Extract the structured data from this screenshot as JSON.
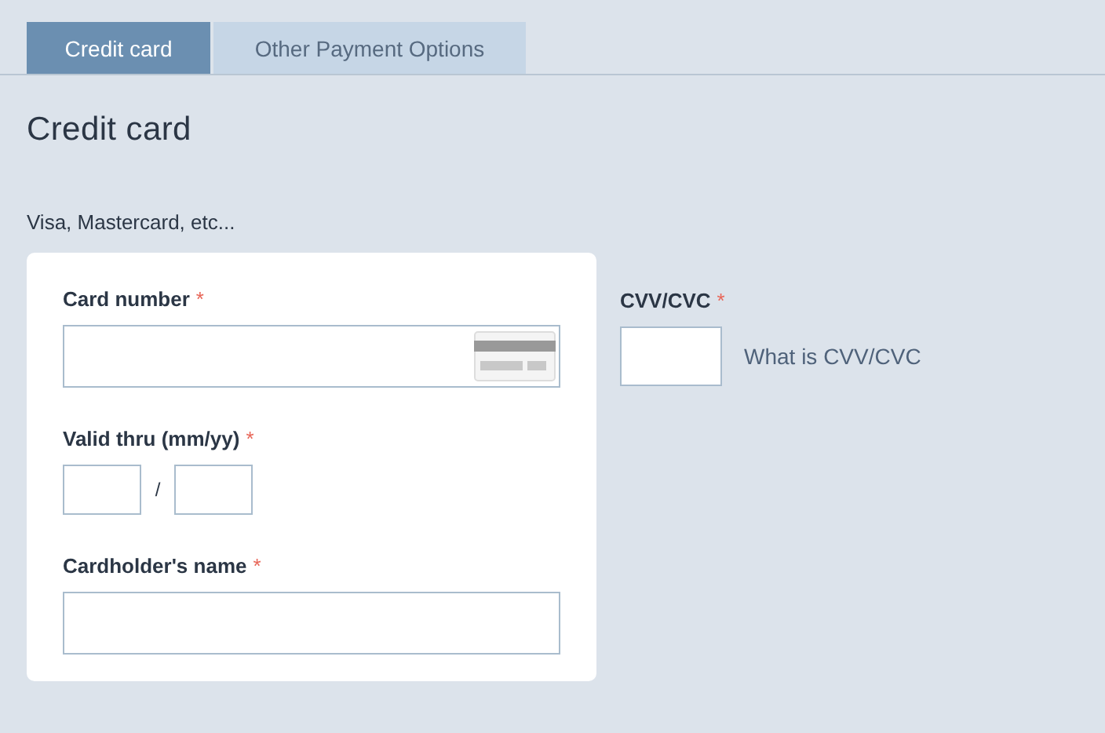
{
  "tabs": [
    {
      "label": "Credit card",
      "selected": true
    },
    {
      "label": "Other Payment Options",
      "selected": false
    }
  ],
  "heading": "Credit card",
  "subtitle": "Visa, Mastercard, etc...",
  "card_form": {
    "card_number": {
      "label": "Card number",
      "required_mark": "*"
    },
    "valid_thru": {
      "label": "Valid thru (mm/yy)",
      "required_mark": "*",
      "separator": "/"
    },
    "cardholder_name": {
      "label": "Cardholder's name",
      "required_mark": "*"
    }
  },
  "cvv": {
    "label": "CVV/CVC",
    "required_mark": "*",
    "help_link": "What is CVV/CVC"
  }
}
